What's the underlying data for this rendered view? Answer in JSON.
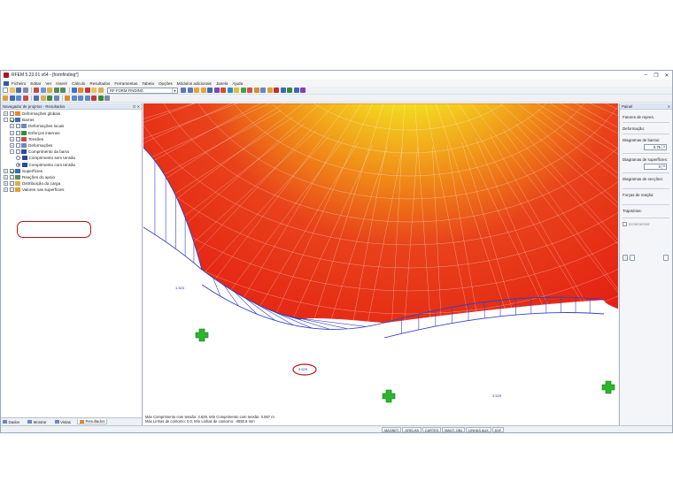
{
  "window": {
    "title": "RFEM 5.23.01 x64 - [formfinding*]",
    "controls": [
      "–",
      "❐",
      "✕"
    ]
  },
  "menu": {
    "items": [
      "Ficheiro",
      "Editar",
      "Ver",
      "Inserir",
      "Cálculo",
      "Resultados",
      "Ferramentas",
      "Tabela",
      "Opções",
      "Módulos adicionais",
      "Janela",
      "Ajuda"
    ]
  },
  "toolbar": {
    "case_combo": "RF-FORM-FINDING"
  },
  "navigator": {
    "title": "Navegador de projetos - Resultados",
    "items": [
      {
        "label": "Deformações globais",
        "depth": 0,
        "expander": "+",
        "check": "empty",
        "icon": "result-icon"
      },
      {
        "label": "Barras",
        "depth": 0,
        "expander": "−",
        "check": "checked",
        "icon": "members-icon"
      },
      {
        "label": "Deformações locais",
        "depth": 1,
        "expander": "+",
        "check": "empty",
        "icon": "deformation-icon"
      },
      {
        "label": "Esforços internos",
        "depth": 1,
        "expander": "+",
        "check": "empty",
        "icon": "forces-icon"
      },
      {
        "label": "Tensões",
        "depth": 1,
        "expander": "+",
        "check": "empty",
        "icon": "stress-icon"
      },
      {
        "label": "Deformações",
        "depth": 1,
        "expander": "+",
        "check": "empty",
        "icon": "deformation-icon"
      },
      {
        "label": "Comprimento da barra",
        "depth": 1,
        "expander": "−",
        "check": "empty",
        "icon": "length-icon"
      },
      {
        "label": "Comprimento sem tensão",
        "depth": 2,
        "radio": "off",
        "icon": "length-icon"
      },
      {
        "label": "Comprimento com tensão",
        "depth": 2,
        "radio": "on",
        "icon": "length-icon"
      },
      {
        "label": "Superfícies",
        "depth": 0,
        "expander": "+",
        "check": "checked",
        "icon": "surface-icon"
      },
      {
        "label": "Reações do apoio",
        "depth": 0,
        "expander": "+",
        "check": "empty",
        "icon": "support-icon"
      },
      {
        "label": "Distribuição da carga",
        "depth": 0,
        "expander": "+",
        "check": "empty",
        "icon": "load-icon"
      },
      {
        "label": "Valores nas superfícies",
        "depth": 0,
        "expander": "+",
        "check": "empty",
        "icon": "values-icon"
      }
    ],
    "tabs": [
      "Dados",
      "Mostrar",
      "Vistas",
      "Resultados"
    ]
  },
  "viewport": {
    "footer_line1": "Máx Comprimento com tensão: 3.529, Mín Comprimento com tensão: 0.087 m",
    "footer_line2": "Máx Linhas de contorno: 0.0, Mín Linhas de contorno: -4550.8 mm",
    "member_labels": [
      "3.529",
      "1.523",
      "3.529",
      "3.529"
    ],
    "axis_x": "X",
    "axis_z": "Z"
  },
  "panel": {
    "title": "Painel",
    "group_title": "Fatores de repres.",
    "deformation_label": "Deformação:",
    "member_diagram_label": "Diagramas de barras:",
    "member_diagram_value": "0.75",
    "surface_diagram_label": "Diagramas de superfícies:",
    "surface_diagram_value": "0",
    "section_diagram_label": "Diagramas de secções:",
    "reaction_label": "Forças de reação:",
    "trajectory_label": "Trajetórias:",
    "increments_label": "Incrementos:"
  },
  "statusbar": {
    "buttons": [
      "MAGNET",
      "GRELHA",
      "CARTES",
      "MAGT. OBJ",
      "LINHAS AUX",
      "DXF"
    ]
  },
  "colors": {
    "accent_red": "#b5121b",
    "surface_red": "#e31a12",
    "surface_yellow": "#f4ee30",
    "support_green": "#2bb52b",
    "member_blue": "#3340c8"
  }
}
